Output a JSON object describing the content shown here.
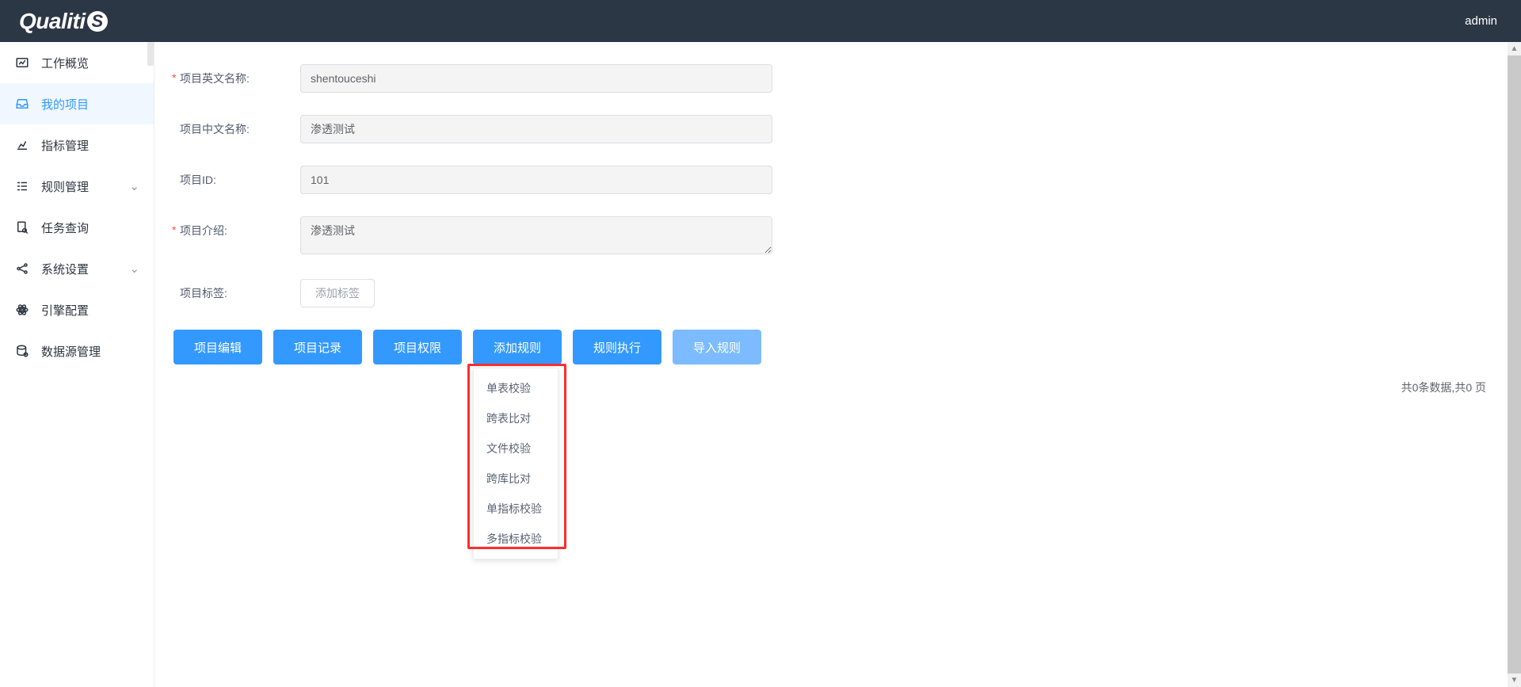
{
  "header": {
    "logo_text": "Qualiti",
    "logo_suffix": "S",
    "user": "admin"
  },
  "sidebar": {
    "items": [
      {
        "label": "工作概览",
        "icon": "dashboard",
        "expandable": false,
        "active": false
      },
      {
        "label": "我的项目",
        "icon": "inbox",
        "expandable": false,
        "active": true
      },
      {
        "label": "指标管理",
        "icon": "chart",
        "expandable": false,
        "active": false
      },
      {
        "label": "规则管理",
        "icon": "list",
        "expandable": true,
        "active": false
      },
      {
        "label": "任务查询",
        "icon": "search-doc",
        "expandable": false,
        "active": false
      },
      {
        "label": "系统设置",
        "icon": "share",
        "expandable": true,
        "active": false
      },
      {
        "label": "引擎配置",
        "icon": "atom",
        "expandable": false,
        "active": false
      },
      {
        "label": "数据源管理",
        "icon": "db",
        "expandable": false,
        "active": false
      }
    ]
  },
  "form": {
    "en_name": {
      "label": "项目英文名称:",
      "value": "shentouceshi",
      "required": true
    },
    "cn_name": {
      "label": "项目中文名称:",
      "value": "渗透测试",
      "required": false
    },
    "id": {
      "label": "项目ID:",
      "value": "101",
      "required": false
    },
    "intro": {
      "label": "项目介绍:",
      "value": "渗透测试",
      "required": true
    },
    "tags": {
      "label": "项目标签:",
      "add_text": "添加标签",
      "required": false
    }
  },
  "buttons": {
    "edit": "项目编辑",
    "record": "项目记录",
    "perm": "项目权限",
    "add_rule": "添加规则",
    "exec": "规则执行",
    "import": "导入规则"
  },
  "dropdown": {
    "items": [
      {
        "label": "单表校验"
      },
      {
        "label": "跨表比对"
      },
      {
        "label": "文件校验"
      },
      {
        "label": "跨库比对"
      },
      {
        "label": "单指标校验"
      },
      {
        "label": "多指标校验"
      }
    ]
  },
  "pager": {
    "text": "共0条数据,共0 页"
  }
}
